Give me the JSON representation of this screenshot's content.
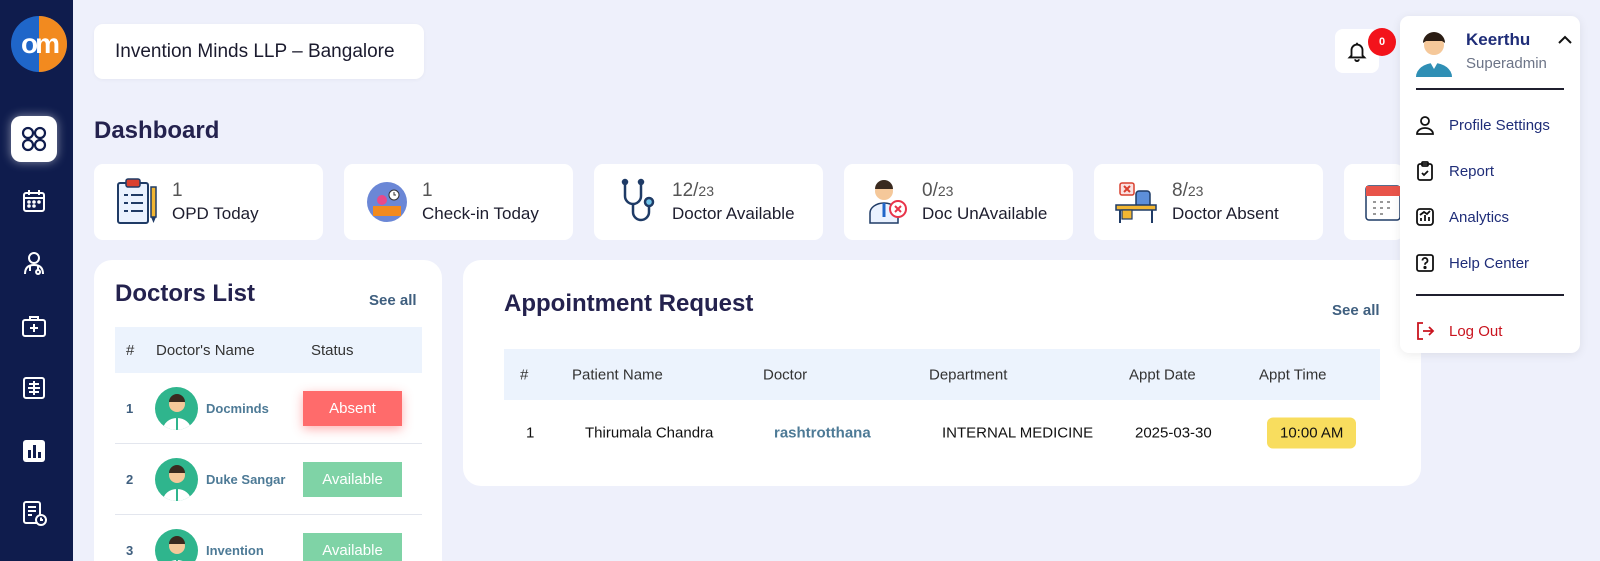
{
  "org": {
    "name": "Invention Minds LLP – Bangalore"
  },
  "logo": {
    "text": "om"
  },
  "notifications": {
    "count": "0"
  },
  "page": {
    "title": "Dashboard"
  },
  "stats": [
    {
      "value": "1",
      "total": "",
      "label": "OPD Today",
      "icon": "clipboard-icon"
    },
    {
      "value": "1",
      "total": "",
      "label": "Check-in Today",
      "icon": "checkin-icon"
    },
    {
      "value": "12/",
      "total": "23",
      "label": "Doctor Available",
      "icon": "stethoscope-icon"
    },
    {
      "value": "0/",
      "total": "23",
      "label": "Doc UnAvailable",
      "icon": "doctor-unavailable-icon"
    },
    {
      "value": "8/",
      "total": "23",
      "label": "Doctor Absent",
      "icon": "empty-desk-icon"
    }
  ],
  "doctors": {
    "title": "Doctors List",
    "see_all": "See all",
    "columns": [
      "#",
      "Doctor's Name",
      "Status"
    ],
    "rows": [
      {
        "idx": "1",
        "name": "Docminds",
        "status": "Absent"
      },
      {
        "idx": "2",
        "name": "Duke Sangar",
        "status": "Available"
      },
      {
        "idx": "3",
        "name": "Invention",
        "status": "Available"
      }
    ]
  },
  "appointments": {
    "title": "Appointment Request",
    "see_all": "See all",
    "columns": [
      "#",
      "Patient Name",
      "Doctor",
      "Department",
      "Appt Date",
      "Appt Time"
    ],
    "rows": [
      {
        "idx": "1",
        "patient": "Thirumala Chandra",
        "doctor": "rashtrotthana",
        "department": "INTERNAL MEDICINE",
        "date": "2025-03-30",
        "time": "10:00 AM"
      }
    ]
  },
  "user_menu": {
    "name": "Keerthu",
    "role": "Superadmin",
    "items": [
      {
        "label": "Profile Settings",
        "icon": "user-icon"
      },
      {
        "label": "Report",
        "icon": "clipboard-report-icon"
      },
      {
        "label": "Analytics",
        "icon": "analytics-icon"
      },
      {
        "label": "Help Center",
        "icon": "help-icon"
      }
    ],
    "logout": "Log Out"
  },
  "colors": {
    "sidebar": "#0f1c4d",
    "background": "#eef0fb",
    "absent": "#ff6b6b",
    "available": "#7fd3a6",
    "time_badge": "#f8dd5e",
    "logout": "#c9141f"
  }
}
